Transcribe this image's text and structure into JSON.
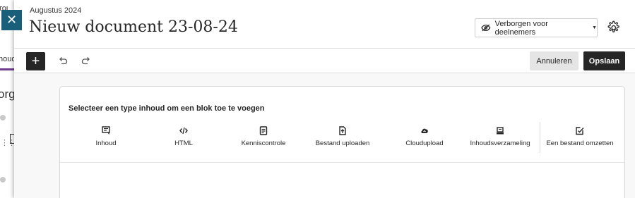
{
  "background_page": {
    "snippet_top": "TOI",
    "snippet_tab": "houd",
    "snippet_heading": "org"
  },
  "close_button": {
    "label": "✕",
    "icon": "close-icon"
  },
  "header": {
    "kicker": "Augustus 2024",
    "title": "Nieuw document 23-08-24",
    "visibility": {
      "label": "Verborgen voor deelnemers",
      "icon": "eye-slash-icon"
    },
    "settings_icon": "gear-icon"
  },
  "toolbar": {
    "add_label": "+",
    "undo_icon": "undo-icon",
    "redo_icon": "redo-icon",
    "cancel_label": "Annuleren",
    "save_label": "Opslaan"
  },
  "content_picker": {
    "title": "Selecteer een type inhoud om een blok toe te voegen",
    "types": [
      {
        "label": "Inhoud",
        "icon": "text-block-icon"
      },
      {
        "label": "HTML",
        "icon": "code-icon"
      },
      {
        "label": "Kenniscontrole",
        "icon": "knowledge-check-icon"
      },
      {
        "label": "Bestand uploaden",
        "icon": "file-upload-icon"
      },
      {
        "label": "Cloudupload",
        "icon": "cloud-upload-icon"
      },
      {
        "label": "Inhoudsverzameling",
        "icon": "content-collection-icon"
      },
      {
        "label": "Een bestand omzetten",
        "icon": "convert-file-icon"
      }
    ]
  },
  "colors": {
    "close_button": "#1a5f7a",
    "primary_button": "#262626",
    "secondary_button": "#e5e5e5",
    "background_accent": "#6c3c8c"
  }
}
